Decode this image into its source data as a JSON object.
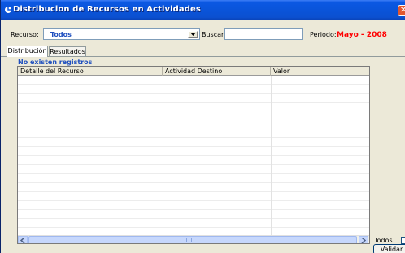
{
  "window": {
    "title": "Distribucion de Recursos en Actividades",
    "close_label": "✕"
  },
  "filters": {
    "recurso_label": "Recurso:",
    "recurso_value": "Todos",
    "buscar_label": "Buscar:",
    "buscar_value": "",
    "periodo_label": "Periodo:",
    "periodo_value": "Mayo - 2008"
  },
  "tabs": [
    {
      "label": "Distribución",
      "active": true
    },
    {
      "label": "Resultados",
      "active": false
    }
  ],
  "grid": {
    "notice": "No existen registros",
    "columns": [
      "Detalle del Recurso",
      "Actividad Destino",
      "Valor"
    ],
    "rows": []
  },
  "footer": {
    "todos_label": "Todos",
    "todos_checked": false,
    "validar_label": "Validar"
  },
  "colors": {
    "titlebar": "#0a54d9",
    "accent_text": "#1f4fbf",
    "period_text": "#ff0000",
    "window_bg": "#ece9d8"
  },
  "icons": [
    "window-icon",
    "close-icon",
    "dropdown-arrow-icon",
    "scroll-left-icon",
    "scroll-right-icon"
  ]
}
